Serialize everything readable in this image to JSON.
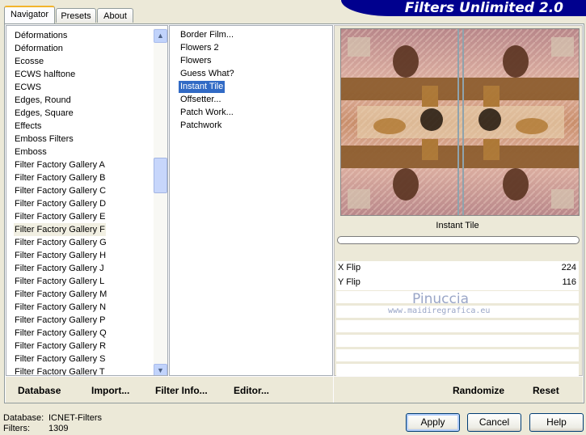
{
  "title": "Filters Unlimited 2.0",
  "tabs": [
    {
      "label": "Navigator"
    },
    {
      "label": "Presets"
    },
    {
      "label": "About"
    }
  ],
  "categories": [
    "Déformations",
    "Déformation",
    "Ecosse",
    "ECWS halftone",
    "ECWS",
    "Edges, Round",
    "Edges, Square",
    "Effects",
    "Emboss Filters",
    "Emboss",
    "Filter Factory Gallery A",
    "Filter Factory Gallery B",
    "Filter Factory Gallery C",
    "Filter Factory Gallery D",
    "Filter Factory Gallery E",
    "Filter Factory Gallery F",
    "Filter Factory Gallery G",
    "Filter Factory Gallery H",
    "Filter Factory Gallery J",
    "Filter Factory Gallery L",
    "Filter Factory Gallery M",
    "Filter Factory Gallery N",
    "Filter Factory Gallery P",
    "Filter Factory Gallery Q",
    "Filter Factory Gallery R",
    "Filter Factory Gallery S",
    "Filter Factory Gallery T"
  ],
  "highlighted_category": "Filter Factory Gallery F",
  "filters": [
    "Border Film...",
    "Flowers 2",
    "Flowers",
    "Guess What?",
    "Instant Tile",
    "Offsetter...",
    "Patch Work...",
    "Patchwork"
  ],
  "selected_filter": "Instant Tile",
  "list_actions": {
    "database": "Database",
    "import": "Import...",
    "filter_info": "Filter Info...",
    "editor": "Editor..."
  },
  "preview": {
    "filter_name": "Instant Tile",
    "progress": 0
  },
  "params": [
    {
      "label": "X Flip",
      "value": "224"
    },
    {
      "label": "Y Flip",
      "value": "116"
    }
  ],
  "watermark": {
    "name": "Pinuccia",
    "site": "www.maidiregrafica.eu"
  },
  "param_actions": {
    "randomize": "Randomize",
    "reset": "Reset"
  },
  "status": {
    "database_label": "Database:",
    "database_value": "ICNET-Filters",
    "filters_label": "Filters:",
    "filters_value": "1309"
  },
  "buttons": {
    "apply": "Apply",
    "cancel": "Cancel",
    "help": "Help"
  },
  "colors": {
    "banner": "#00008E",
    "selection": "#316AC5",
    "window_bg": "#ECE9D8"
  }
}
